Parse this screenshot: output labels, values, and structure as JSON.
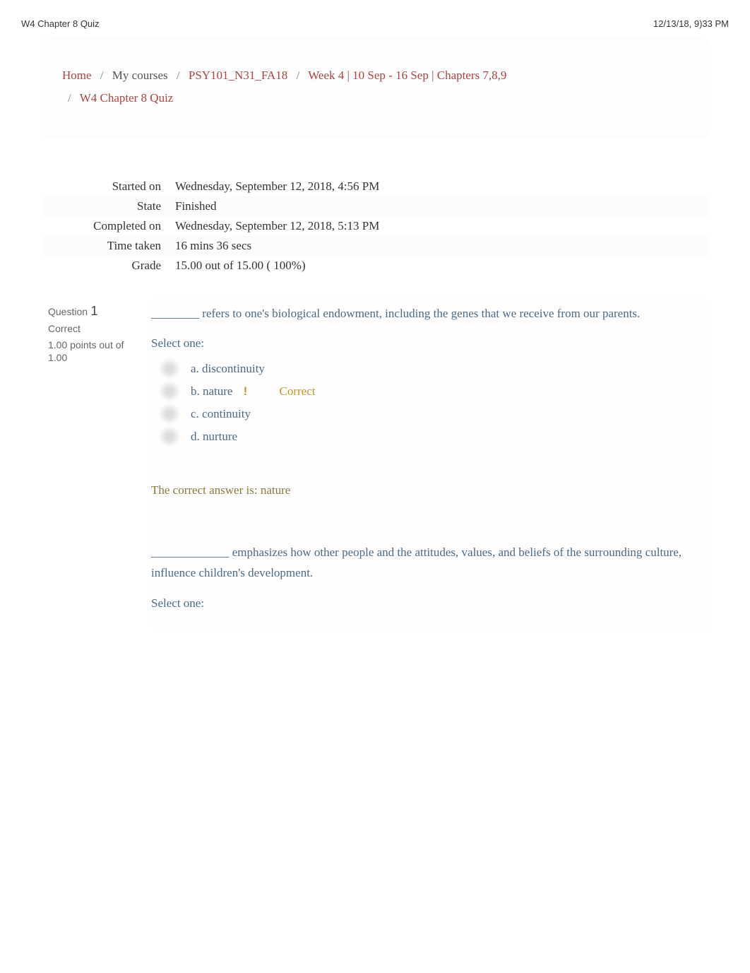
{
  "header": {
    "left": "W4 Chapter 8 Quiz",
    "right": "12/13/18, 9)33 PM"
  },
  "breadcrumb": {
    "home": "Home",
    "my_courses": "My courses",
    "course": "PSY101_N31_FA18",
    "week": "Week 4 | 10 Sep - 16 Sep | Chapters 7,8,9",
    "current": "W4 Chapter 8 Quiz"
  },
  "summary": {
    "started_on_label": "Started on",
    "started_on_value": "Wednesday, September 12, 2018, 4:56 PM",
    "state_label": "State",
    "state_value": "Finished",
    "completed_on_label": "Completed on",
    "completed_on_value": "Wednesday, September 12, 2018, 5:13 PM",
    "time_taken_label": "Time taken",
    "time_taken_value": "16 mins 36 secs",
    "grade_label": "Grade",
    "grade_value": "15.00  out of 15.00 (  100%)"
  },
  "q1": {
    "question_label": "Question",
    "number": "1",
    "status": "Correct",
    "points": "1.00 points out of 1.00",
    "text": "________ refers to one's biological endowment, including the genes that we receive from our parents.",
    "select_one": "Select one:",
    "options": {
      "a": "a. discontinuity",
      "b": "b. nature",
      "c": "c. continuity",
      "d": "d. nurture"
    },
    "correct_label": "Correct",
    "correct_answer": "The correct answer is: nature"
  },
  "q2": {
    "text": "_____________ emphasizes how other people and the attitudes, values, and beliefs of the surrounding culture, influence children's development.",
    "select_one": "Select one:"
  }
}
